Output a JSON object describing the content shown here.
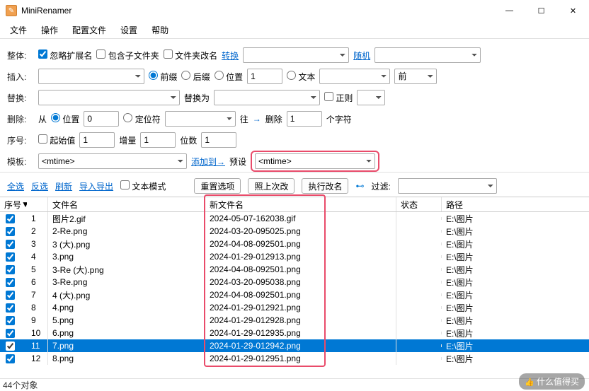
{
  "window": {
    "title": "MiniRenamer"
  },
  "menu": [
    "文件",
    "操作",
    "配置文件",
    "设置",
    "帮助"
  ],
  "rows": {
    "overall": {
      "label": "整体:",
      "ignore_ext": "忽略扩展名",
      "include_sub": "包含子文件夹",
      "rename_folder": "文件夹改名",
      "convert": "转换",
      "random": "随机"
    },
    "insert": {
      "label": "插入:",
      "prefix": "前缀",
      "suffix": "后缀",
      "position": "位置",
      "pos_val": "1",
      "text": "文本",
      "before": "前"
    },
    "replace": {
      "label": "替换:",
      "replace_with": "替换为",
      "regex": "正则"
    },
    "delete": {
      "label": "删除:",
      "from": "从",
      "position": "位置",
      "pos_val": "0",
      "locator": "定位符",
      "go": "往",
      "del": "删除",
      "del_val": "1",
      "chars": "个字符"
    },
    "seq": {
      "label": "序号:",
      "start": "起始值",
      "start_val": "1",
      "step": "增量",
      "step_val": "1",
      "digits": "位数",
      "digits_val": "1"
    },
    "template": {
      "label": "模板:",
      "value": "<mtime>",
      "addto": "添加到→",
      "preset": "预设",
      "preset_value": "<mtime>"
    }
  },
  "toolbar": {
    "select_all": "全选",
    "invert": "反选",
    "refresh": "刷新",
    "import_export": "导入导出",
    "text_mode": "文本模式",
    "reset": "重置选项",
    "last_change": "照上次改",
    "execute": "执行改名",
    "filter": "过滤:"
  },
  "columns": {
    "num": "序号",
    "name": "文件名",
    "newname": "新文件名",
    "status": "状态",
    "path": "路径"
  },
  "files": [
    {
      "n": "1",
      "name": "图片2.gif",
      "new": "2024-05-07-162038.gif",
      "path": "E:\\图片"
    },
    {
      "n": "2",
      "name": "2-Re.png",
      "new": "2024-03-20-095025.png",
      "path": "E:\\图片"
    },
    {
      "n": "3",
      "name": "3 (大).png",
      "new": "2024-04-08-092501.png",
      "path": "E:\\图片"
    },
    {
      "n": "4",
      "name": "3.png",
      "new": "2024-01-29-012913.png",
      "path": "E:\\图片"
    },
    {
      "n": "5",
      "name": "3-Re (大).png",
      "new": "2024-04-08-092501.png",
      "path": "E:\\图片"
    },
    {
      "n": "6",
      "name": "3-Re.png",
      "new": "2024-03-20-095038.png",
      "path": "E:\\图片"
    },
    {
      "n": "7",
      "name": "4 (大).png",
      "new": "2024-04-08-092501.png",
      "path": "E:\\图片"
    },
    {
      "n": "8",
      "name": "4.png",
      "new": "2024-01-29-012921.png",
      "path": "E:\\图片"
    },
    {
      "n": "9",
      "name": "5.png",
      "new": "2024-01-29-012928.png",
      "path": "E:\\图片"
    },
    {
      "n": "10",
      "name": "6.png",
      "new": "2024-01-29-012935.png",
      "path": "E:\\图片"
    },
    {
      "n": "11",
      "name": "7.png",
      "new": "2024-01-29-012942.png",
      "path": "E:\\图片",
      "sel": true
    },
    {
      "n": "12",
      "name": "8.png",
      "new": "2024-01-29-012951.png",
      "path": "E:\\图片"
    }
  ],
  "status": "44个对象",
  "watermark": "什么值得买"
}
